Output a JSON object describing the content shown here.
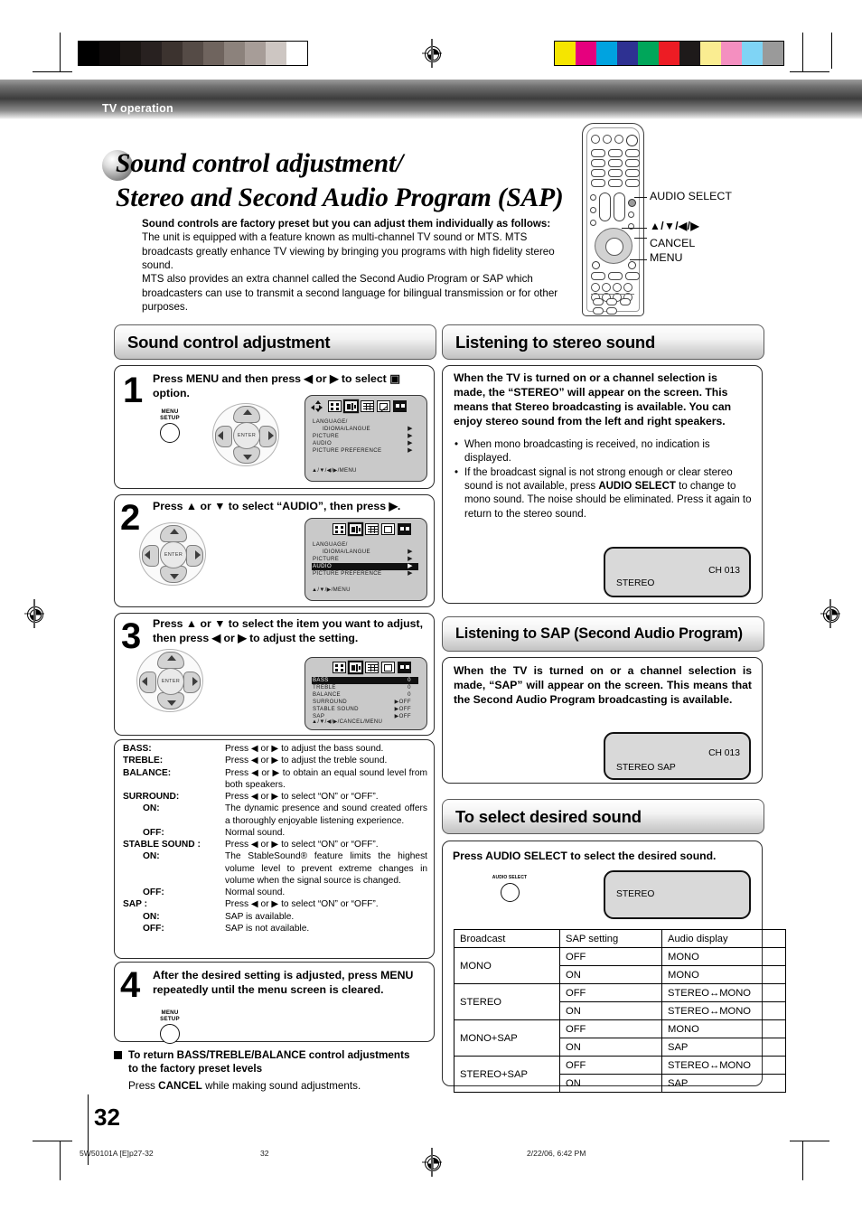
{
  "header": {
    "section": "TV operation"
  },
  "title": {
    "line1": "Sound control adjustment/",
    "line2": "Stereo and Second Audio Program (SAP)"
  },
  "intro": {
    "lead": "Sound controls are factory preset but you can adjust them individually as follows:",
    "p1": "The unit is equipped with a feature known as multi-channel TV sound or MTS. MTS broadcasts greatly enhance TV viewing by bringing you programs with high fidelity stereo sound.",
    "p2": "MTS also provides an extra channel called the Second Audio Program or SAP which broadcasters can use to transmit a second language for bilingual transmission or for other purposes."
  },
  "remote": {
    "labels": {
      "audio_select": "AUDIO SELECT",
      "arrows": "▲/▼/◀/▶",
      "cancel": "CANCEL",
      "menu": "MENU"
    }
  },
  "sections": {
    "sound_control": "Sound control adjustment",
    "listening_stereo": "Listening to stereo sound",
    "listening_sap": "Listening to SAP (Second Audio Program)",
    "select_sound": "To select desired sound"
  },
  "steps": [
    {
      "num": "1",
      "text": "Press MENU and then press ◀ or ▶ to select ▣ option."
    },
    {
      "num": "2",
      "text": "Press ▲ or ▼ to select “AUDIO”, then press ▶."
    },
    {
      "num": "3",
      "text": "Press ▲ or ▼ to select the item you want to adjust, then press ◀ or ▶ to adjust the setting."
    },
    {
      "num": "4",
      "text": "After the desired setting is adjusted, press MENU repeatedly until the menu screen is cleared."
    }
  ],
  "buttons": {
    "menu_setup_line1": "MENU",
    "menu_setup_line2": "SETUP",
    "enter": "ENTER",
    "audio_select_cap": "AUDIO SELECT"
  },
  "osd_main": {
    "rows": [
      {
        "label": "LANGUAGE/",
        "arrow": ""
      },
      {
        "label": "IDIOMA/LANGUE",
        "arrow": "▶"
      },
      {
        "label": "PICTURE",
        "arrow": "▶"
      },
      {
        "label": "AUDIO",
        "arrow": "▶"
      },
      {
        "label": "PICTURE PREFERENCE",
        "arrow": "▶"
      }
    ],
    "footer_step1": "▲/▼/◀/▶/MENU",
    "footer_step2": "▲/▼/▶/MENU"
  },
  "osd_audio": {
    "rows": [
      {
        "label": "BASS",
        "value": "0"
      },
      {
        "label": "TREBLE",
        "value": "0"
      },
      {
        "label": "BALANCE",
        "value": "0"
      },
      {
        "label": "SURROUND",
        "value": "▶OFF"
      },
      {
        "label": "STABLE SOUND",
        "value": "▶OFF"
      },
      {
        "label": "SAP",
        "value": "▶OFF"
      }
    ],
    "footer": "▲/▼/◀/▶/CANCEL/MENU"
  },
  "settings": [
    {
      "term": "BASS:",
      "indent": false,
      "desc": "Press ◀ or ▶ to adjust the bass sound."
    },
    {
      "term": "TREBLE:",
      "indent": false,
      "desc": "Press ◀ or ▶ to adjust the treble sound."
    },
    {
      "term": "BALANCE:",
      "indent": false,
      "desc": "Press ◀ or ▶ to obtain an equal sound level from both speakers."
    },
    {
      "term": "SURROUND:",
      "indent": false,
      "desc": "Press ◀ or ▶ to select “ON” or “OFF”."
    },
    {
      "term": "ON:",
      "indent": true,
      "desc": "The dynamic presence and sound created offers a thoroughly enjoyable listening experience."
    },
    {
      "term": "OFF:",
      "indent": true,
      "desc": "Normal sound."
    },
    {
      "term": "STABLE SOUND :",
      "indent": false,
      "desc": "Press ◀ or ▶ to select “ON” or “OFF”."
    },
    {
      "term": "ON:",
      "indent": true,
      "desc": "The StableSound® feature limits the highest volume level to prevent extreme changes in volume when the signal source is changed."
    },
    {
      "term": "OFF:",
      "indent": true,
      "desc": "Normal sound."
    },
    {
      "term": "SAP :",
      "indent": false,
      "desc": "Press ◀ or ▶ to select “ON” or “OFF”."
    },
    {
      "term": "ON:",
      "indent": true,
      "desc": "SAP is available."
    },
    {
      "term": "OFF:",
      "indent": true,
      "desc": "SAP is not available."
    }
  ],
  "note": {
    "heading": "To return BASS/TREBLE/BALANCE control adjustments to the factory preset levels",
    "body_pre": "Press ",
    "body_bold": "CANCEL",
    "body_post": " while making sound adjustments."
  },
  "stereo_block": {
    "lead": "When the TV is turned on or a channel selection is made, the “STEREO” will appear on the screen. This means that Stereo broadcasting is available. You can enjoy stereo sound from the left and right speakers.",
    "bullet1": "When mono broadcasting is received, no indication is displayed.",
    "bullet2_pre": "If the broadcast signal is not strong enough or clear stereo sound is not available, press ",
    "bullet2_bold": "AUDIO SELECT",
    "bullet2_post": " to change to mono sound. The noise should be eliminated. Press it again to return to the stereo sound.",
    "screen": {
      "channel": "CH 013",
      "mode": "STEREO"
    }
  },
  "sap_block": {
    "lead": "When the TV is turned on or a channel selection is made, “SAP” will appear on the screen. This means that the Second Audio Program broadcasting is available.",
    "screen": {
      "channel": "CH 013",
      "mode": "STEREO  SAP"
    }
  },
  "select_block": {
    "lead": "Press AUDIO SELECT to select the desired sound.",
    "screen": {
      "mode": "STEREO"
    }
  },
  "audio_table": {
    "headers": [
      "Broadcast",
      "SAP setting",
      "Audio display"
    ],
    "rows": [
      {
        "broadcast": "MONO",
        "span": 2,
        "sap": "OFF",
        "display": "MONO"
      },
      {
        "broadcast": "",
        "span": 0,
        "sap": "ON",
        "display": "MONO"
      },
      {
        "broadcast": "STEREO",
        "span": 2,
        "sap": "OFF",
        "display": "STEREO↔MONO"
      },
      {
        "broadcast": "",
        "span": 0,
        "sap": "ON",
        "display": "STEREO↔MONO"
      },
      {
        "broadcast": "MONO+SAP",
        "span": 2,
        "sap": "OFF",
        "display": "MONO"
      },
      {
        "broadcast": "",
        "span": 0,
        "sap": "ON",
        "display": "SAP"
      },
      {
        "broadcast": "STEREO+SAP",
        "span": 2,
        "sap": "OFF",
        "display": "STEREO↔MONO"
      },
      {
        "broadcast": "",
        "span": 0,
        "sap": "ON",
        "display": "SAP"
      }
    ]
  },
  "footer": {
    "page_number": "32",
    "file_id": "5W50101A [E]p27-32",
    "center_page": "32",
    "timestamp": "2/22/06, 6:42 PM"
  },
  "swatches": {
    "gray": [
      "#000000",
      "#0d0a0a",
      "#1b1614",
      "#282120",
      "#3c332f",
      "#554b46",
      "#6f645e",
      "#8c827c",
      "#a79d98",
      "#cdc6c2",
      "#ffffff"
    ],
    "color": [
      "#f5e500",
      "#e6007e",
      "#00a3e0",
      "#2e3192",
      "#00a65a",
      "#ed1c24",
      "#1e1a1a",
      "#faed91",
      "#f48fc0",
      "#7fd4f5",
      "#9a9a9a"
    ]
  }
}
